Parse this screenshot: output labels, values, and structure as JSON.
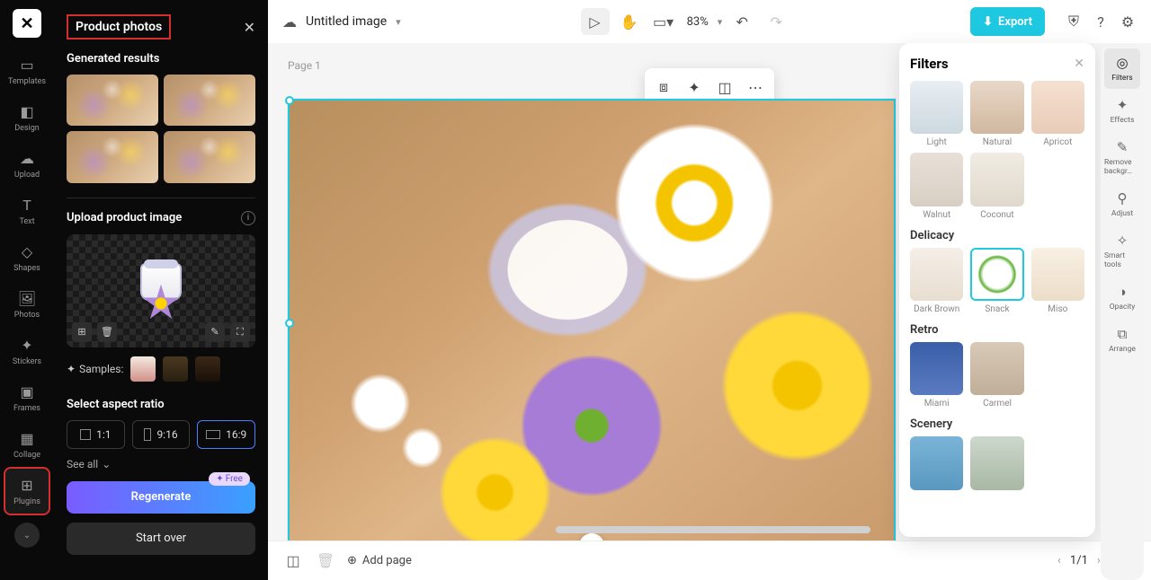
{
  "rail": {
    "templates": "Templates",
    "design": "Design",
    "upload": "Upload",
    "text": "Text",
    "shapes": "Shapes",
    "photos": "Photos",
    "stickers": "Stickers",
    "frames": "Frames",
    "collage": "Collage",
    "plugins": "Plugins"
  },
  "panel": {
    "title": "Product photos",
    "generated": "Generated results",
    "upload_title": "Upload product image",
    "samples": "Samples:",
    "aspect_title": "Select aspect ratio",
    "aspect": {
      "a11": "1:1",
      "a916": "9:16",
      "a169": "16:9"
    },
    "see_all": "See all",
    "free": "Free",
    "regenerate": "Regenerate",
    "start_over": "Start over"
  },
  "top": {
    "title": "Untitled image",
    "zoom": "83%",
    "export": "Export"
  },
  "canvas": {
    "page_label": "Page 1"
  },
  "bottom": {
    "add_page": "Add page",
    "page_count": "1/1"
  },
  "filters": {
    "title": "Filters",
    "row1": {
      "light": "Light",
      "natural": "Natural",
      "apricot": "Apricot"
    },
    "row2": {
      "walnut": "Walnut",
      "coconut": "Coconut"
    },
    "delicacy": "Delicacy",
    "row3": {
      "darkbrown": "Dark Brown",
      "snack": "Snack",
      "miso": "Miso"
    },
    "retro": "Retro",
    "row4": {
      "miami": "Miami",
      "carmel": "Carmel"
    },
    "scenery": "Scenery"
  },
  "right_rail": {
    "filters": "Filters",
    "effects": "Effects",
    "remove_bg": "Remove backgr…",
    "adjust": "Adjust",
    "smart_tools": "Smart tools",
    "opacity": "Opacity",
    "arrange": "Arrange"
  }
}
